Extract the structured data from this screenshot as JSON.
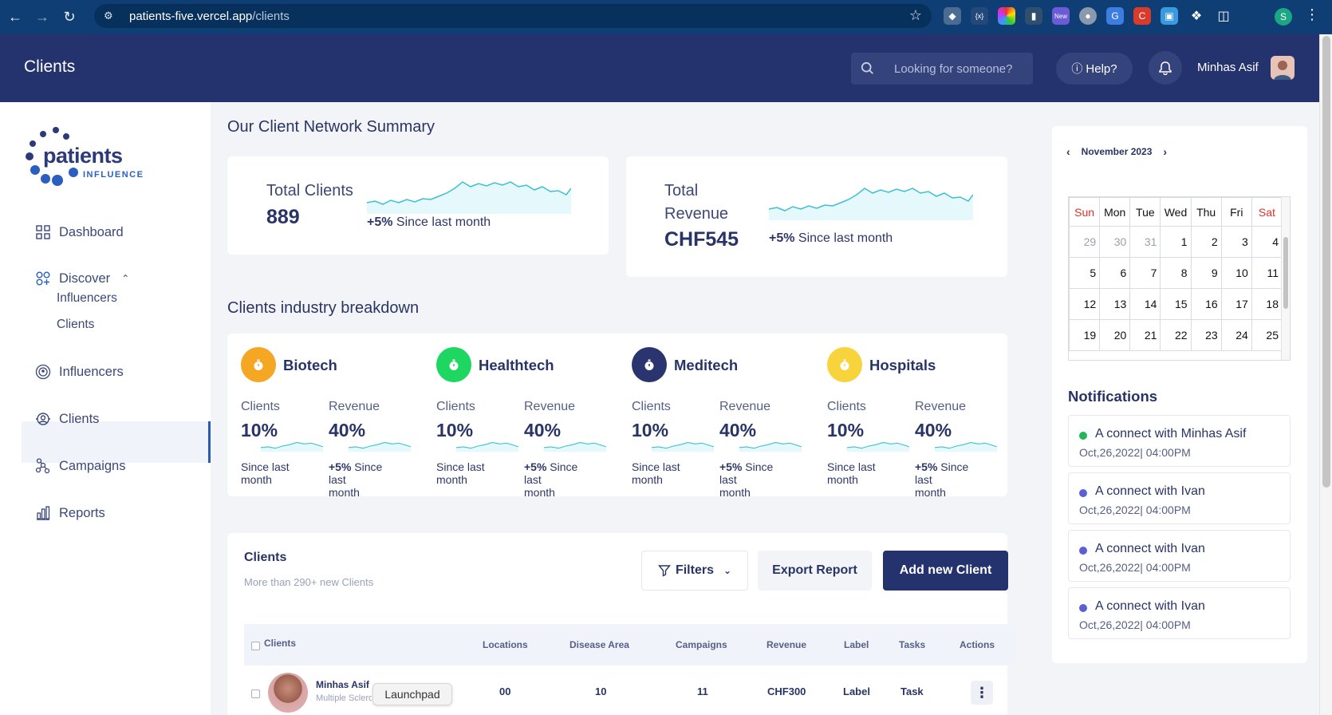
{
  "browser": {
    "url_host": "patients-five.vercel.app",
    "url_path": "/clients",
    "profile_initial": "S"
  },
  "header": {
    "title": "Clients",
    "search_placeholder": "Looking for someone?",
    "help_label": "Help?",
    "user_name": "Minhas Asif"
  },
  "logo": {
    "word": "patients",
    "sub": "INFLUENCE"
  },
  "sidebar": {
    "items": [
      {
        "label": "Dashboard",
        "icon": "dashboard-icon"
      },
      {
        "label": "Discover",
        "icon": "discover-icon"
      },
      {
        "label": "Influencers",
        "icon": "influencers-icon"
      },
      {
        "label": "Clients",
        "icon": "clients-icon"
      },
      {
        "label": "Campaigns",
        "icon": "campaigns-icon"
      },
      {
        "label": "Reports",
        "icon": "reports-icon"
      }
    ],
    "sub_items": [
      "Influencers",
      "Clients"
    ]
  },
  "summary": {
    "heading": "Our Client Network Summary",
    "clients": {
      "label": "Total Clients",
      "value": "889",
      "change": "+5%",
      "since": "Since last month"
    },
    "revenue": {
      "label_1": "Total",
      "label_2": "Revenue",
      "value": "CHF545",
      "change": "+5%",
      "since": "Since last month"
    }
  },
  "breakdown": {
    "heading": "Clients industry breakdown",
    "clients_label": "Clients",
    "revenue_label": "Revenue",
    "industries": [
      {
        "name": "Biotech",
        "color": "#f5a623",
        "clients": "10%",
        "revenue": "40%"
      },
      {
        "name": "Healthtech",
        "color": "#1ed760",
        "clients": "10%",
        "revenue": "40%"
      },
      {
        "name": "Meditech",
        "color": "#2a3570",
        "clients": "10%",
        "revenue": "40%"
      },
      {
        "name": "Hospitals",
        "color": "#f7d43c",
        "clients": "10%",
        "revenue": "40%"
      }
    ],
    "since_clients_1": "Since last",
    "since_clients_2": "month",
    "since_rev_change": "+5%",
    "since_rev_1": " Since",
    "since_rev_2": "last",
    "since_rev_3": "month"
  },
  "table": {
    "title": "Clients",
    "subtitle": "More than 290+ new Clients",
    "filters_label": "Filters",
    "export_label": "Export Report",
    "add_label": "Add new Client",
    "columns": [
      "Clients",
      "Locations",
      "Disease Area",
      "Campaigns",
      "Revenue",
      "Label",
      "Tasks",
      "Actions"
    ],
    "row": {
      "name": "Minhas Asif",
      "sub": "Multiple Sclerosis",
      "locations": "00",
      "disease_area": "10",
      "campaigns": "11",
      "revenue": "CHF300",
      "label": "Label",
      "tasks": "Task"
    },
    "tooltip": "Launchpad"
  },
  "calendar": {
    "month": "November 2023",
    "days": [
      "Sun",
      "Mon",
      "Tue",
      "Wed",
      "Thu",
      "Fri",
      "Sat"
    ],
    "weeks": [
      [
        "29",
        "30",
        "31",
        "1",
        "2",
        "3",
        "4"
      ],
      [
        "5",
        "6",
        "7",
        "8",
        "9",
        "10",
        "11"
      ],
      [
        "12",
        "13",
        "14",
        "15",
        "16",
        "17",
        "18"
      ],
      [
        "19",
        "20",
        "21",
        "22",
        "23",
        "24",
        "25"
      ]
    ]
  },
  "notifications": {
    "title": "Notifications",
    "items": [
      {
        "text": "A connect with Minhas Asif",
        "time": "Oct,26,2022| 04:00PM",
        "color": "#22b55a"
      },
      {
        "text": "A connect with Ivan",
        "time": "Oct,26,2022| 04:00PM",
        "color": "#5b5fd6"
      },
      {
        "text": "A connect with Ivan",
        "time": "Oct,26,2022| 04:00PM",
        "color": "#5b5fd6"
      },
      {
        "text": "A connect with Ivan",
        "time": "Oct,26,2022| 04:00PM",
        "color": "#5b5fd6"
      }
    ]
  }
}
